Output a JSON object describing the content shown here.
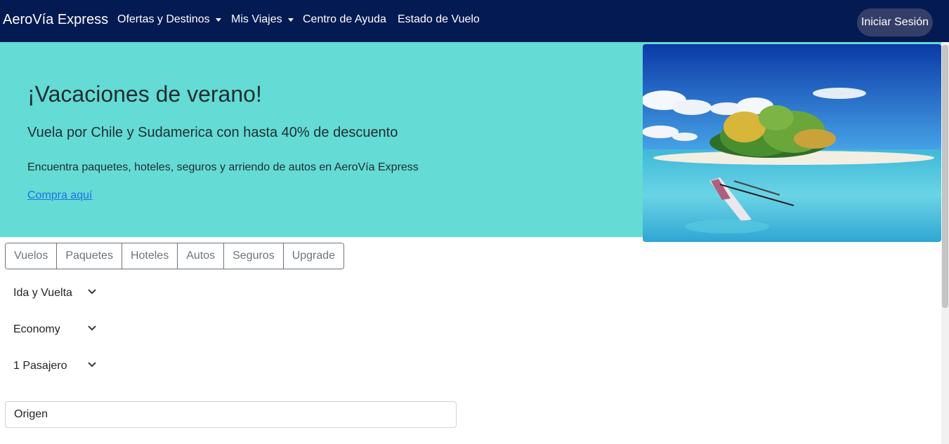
{
  "navbar": {
    "brand": "AeroVía Express",
    "items": [
      {
        "label": "Ofertas y Destinos",
        "dropdown": true
      },
      {
        "label": "Mis Viajes",
        "dropdown": true
      },
      {
        "label": "Centro de Ayuda",
        "dropdown": false
      },
      {
        "label": "Estado de Vuelo",
        "dropdown": false
      }
    ],
    "login_label": "Iniciar Sesión"
  },
  "hero": {
    "title": "¡Vacaciones de verano!",
    "subtitle": "Vuela por Chile y Sudamerica con hasta 40% de descuento",
    "text": "Encuentra paquetes, hoteles, seguros y arriendo de autos en AeroVía Express",
    "link": "Compra aquí",
    "image_icon": "tropical-island-photo"
  },
  "tabs": [
    "Vuelos",
    "Paquetes",
    "Hoteles",
    "Autos",
    "Seguros",
    "Upgrade"
  ],
  "selects": {
    "trip_type": "Ida y Vuelta",
    "cabin": "Economy",
    "passengers": "1 Pasajero"
  },
  "origin": {
    "value": "Origen"
  },
  "colors": {
    "navbar": "#041a52",
    "hero": "#64dbd4",
    "login_button": "#353e68",
    "link": "#1a73e8"
  }
}
